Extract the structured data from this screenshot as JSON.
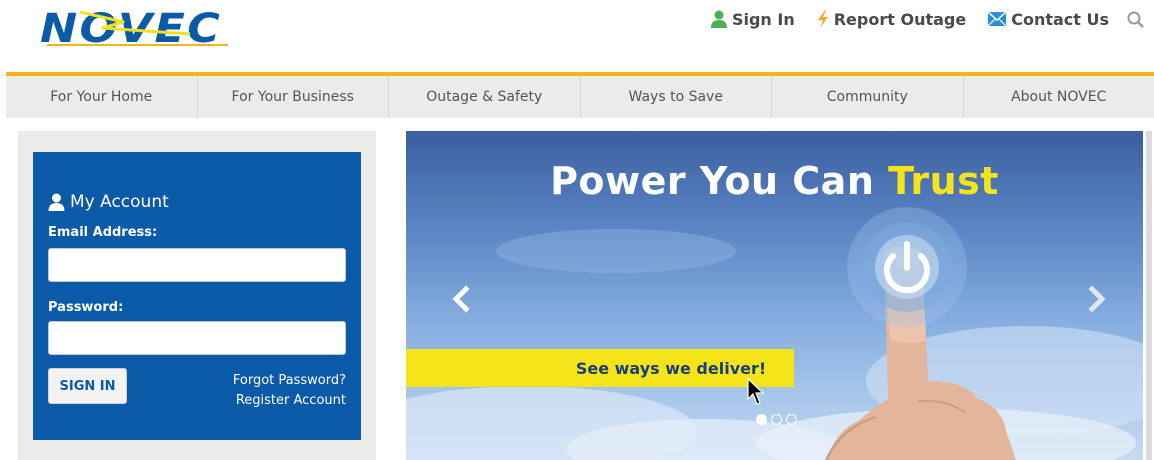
{
  "header": {
    "logo_text": "NOVEC",
    "util": {
      "sign_in": "Sign In",
      "report_outage": "Report Outage",
      "contact_us": "Contact Us"
    }
  },
  "nav": {
    "items": [
      "For Your Home",
      "For Your Business",
      "Outage & Safety",
      "Ways to Save",
      "Community",
      "About NOVEC"
    ]
  },
  "account": {
    "title": "My Account",
    "email_label": "Email Address:",
    "email_value": "",
    "password_label": "Password:",
    "password_value": "",
    "signin_label": "SIGN IN",
    "forgot_label": "Forgot Password?",
    "register_label": "Register Account"
  },
  "hero": {
    "title_main": "Power You Can ",
    "title_accent": "Trust",
    "cta_label": "See ways we deliver!",
    "slides": 3,
    "active_slide": 1
  },
  "colors": {
    "brand_blue": "#0a5aa8",
    "accent_yellow": "#f5e41a",
    "nav_border": "#f3b516",
    "icon_green": "#4caf50",
    "icon_orange": "#f5a623",
    "icon_blue": "#2a8fd6"
  },
  "icons": [
    "user-icon",
    "lightning-icon",
    "envelope-icon",
    "search-icon",
    "chevron-left-icon",
    "chevron-right-icon",
    "power-icon",
    "cursor-icon"
  ]
}
